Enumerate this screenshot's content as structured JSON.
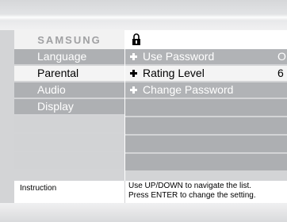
{
  "brand": "SAMSUNG",
  "header_icon": "lock-icon",
  "menu": {
    "items": [
      {
        "label": "Language"
      },
      {
        "label": "Parental"
      },
      {
        "label": "Audio"
      },
      {
        "label": "Display"
      }
    ],
    "selected": "Parental"
  },
  "submenu": {
    "items": [
      {
        "label": "Use Password",
        "value": "O"
      },
      {
        "label": "Rating Level",
        "value": "6"
      },
      {
        "label": "Change Password",
        "value": ""
      }
    ],
    "selected": "Rating Level"
  },
  "instruction": {
    "label": "Instruction",
    "line1": "Use UP/DOWN to navigate the list.",
    "line2": "Press ENTER to change the setting."
  },
  "colors": {
    "item_gray": "#aeb0b3",
    "selected_bg": "#f4f4f4"
  }
}
